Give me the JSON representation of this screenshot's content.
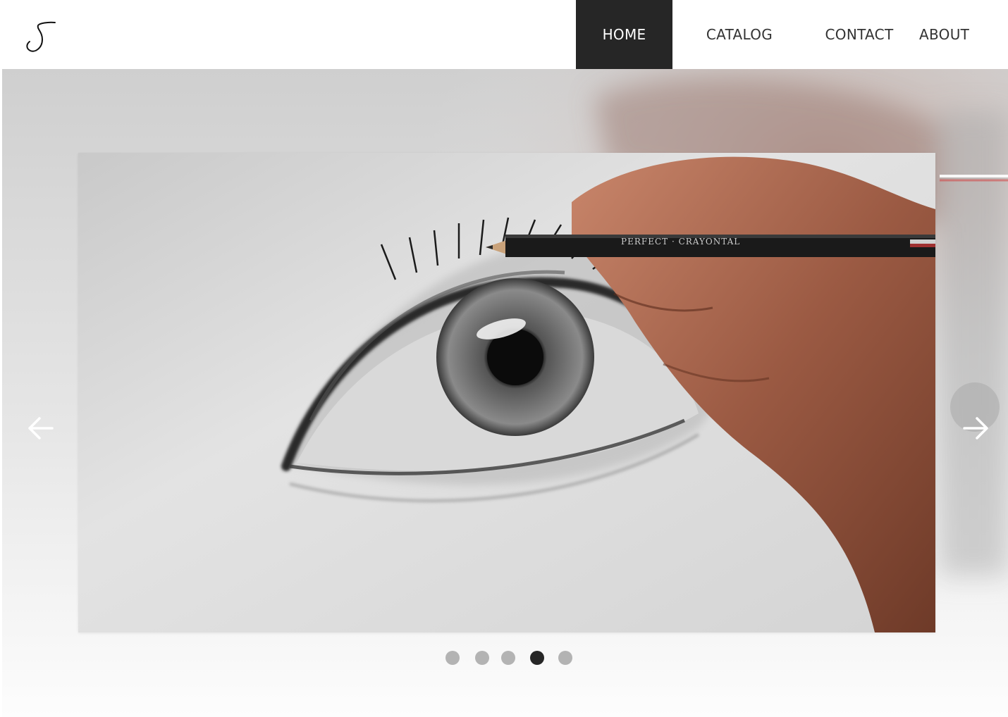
{
  "brand": {
    "logo_alt": "S"
  },
  "nav": {
    "items": [
      {
        "id": "home",
        "label": "HOME",
        "active": true
      },
      {
        "id": "catalog",
        "label": "CATALOG",
        "active": false
      },
      {
        "id": "contact",
        "label": "CONTACT",
        "active": false
      },
      {
        "id": "about",
        "label": "ABOUT",
        "active": false
      }
    ]
  },
  "slider": {
    "prev_icon": "arrow-left-icon",
    "next_icon": "arrow-right-icon",
    "slide_count": 5,
    "active_index": 3,
    "image_subject": "pencil drawing of an eye"
  },
  "colors": {
    "nav_active_bg": "#262626",
    "nav_text": "#333333",
    "dot": "#b3b3b3",
    "dot_active": "#262626"
  }
}
